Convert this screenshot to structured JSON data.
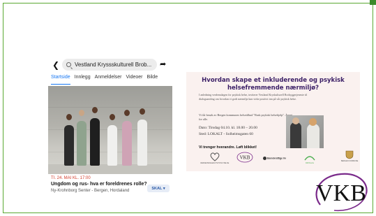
{
  "event_screenshot": {
    "search_query": "Vestland Kryssskulturell Brob...",
    "tabs": [
      {
        "label": "Startside",
        "active": true
      },
      {
        "label": "Innlegg",
        "active": false
      },
      {
        "label": "Anmeldelser",
        "active": false
      },
      {
        "label": "Videoer",
        "active": false
      },
      {
        "label": "Bilde",
        "active": false
      }
    ],
    "date": "TI. 24. MAI KL. 17:00",
    "title": "Ungdom og rus- hva er foreldrenes rolle?",
    "location": "Ny-Krohnborg Senter - Bergen, Hordaland",
    "button_label": "SKAL",
    "accent_color": "#1877f2",
    "date_color": "#d23b2a"
  },
  "poster": {
    "title": "Hvordan skape et inkluderende og psykisk helsefremmende nærmiljø?",
    "intro": "I anledning verdensdagen for psykisk helse, inviterer Vestland Kryskulturell Brobyggerjeneste til dialogsamling om hvordan vi godt nærmiljø kan virke positivt inn på vår psykisk helse.",
    "invite": "Vi får besøk av Bergen kommunes helsetilbud \"Rask psykisk helsehjelp\". Åpent for alle.",
    "date_line": "Dato: Tirsdag 04.10. kl. 18.00 – 20.00",
    "place_line": "Sted: LOKALT - Solheimsgaten 60",
    "slogan": "Vi trenger hverandre. Løft blikket!",
    "logos": [
      {
        "name": "Verdensdagen psykisk helse",
        "caption": "VERDENSDAGEN PSYKISK HELSE"
      },
      {
        "name": "VKB",
        "caption": "VKB"
      },
      {
        "name": "Bærekraftige liv",
        "caption": "Bærekraftige liv"
      },
      {
        "name": "Frivillig",
        "caption": "FRIVILLIG"
      },
      {
        "name": "Bergen kommune",
        "caption": "BERGEN KOMMUNE"
      }
    ],
    "title_color": "#3b1f66",
    "background_color": "#faf1ef"
  },
  "brand_logo": {
    "text": "VKB",
    "ring_color": "#7a2a8a"
  },
  "frame_color": "#5aa832"
}
